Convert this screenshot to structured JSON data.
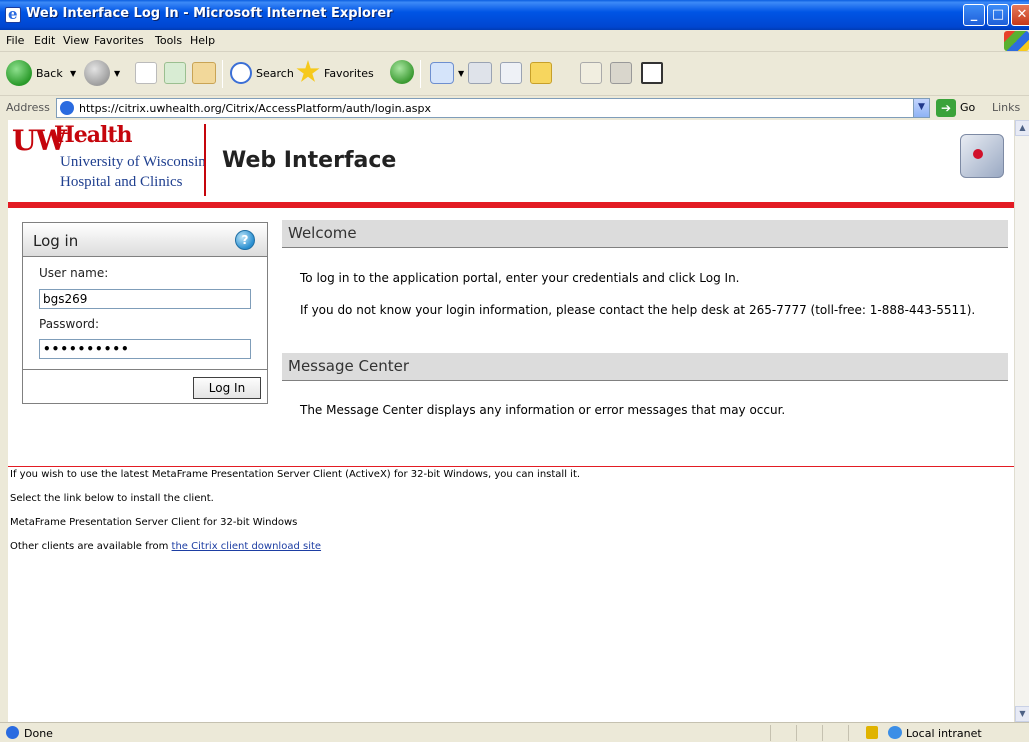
{
  "window": {
    "title": "Web Interface Log In - Microsoft Internet Explorer",
    "minimize": "_",
    "maximize": "□",
    "close": "✕"
  },
  "menu": [
    "File",
    "Edit",
    "View",
    "Favorites",
    "Tools",
    "Help"
  ],
  "toolbar": {
    "back_label": "Back",
    "search_label": "Search",
    "favorites_label": "Favorites"
  },
  "address": {
    "label": "Address",
    "url": "https://citrix.uwhealth.org/Citrix/AccessPlatform/auth/login.aspx",
    "go_label": "Go",
    "links_label": "Links"
  },
  "header": {
    "logo_uw": "UW",
    "logo_health": "Health",
    "sub1": "University of Wisconsin",
    "sub2": "Hospital and Clinics",
    "title": "Web Interface"
  },
  "login": {
    "title": "Log in",
    "username_label": "User name:",
    "username_value": "bgs269",
    "password_label": "Password:",
    "password_value": "••••••••••",
    "button": "Log In"
  },
  "welcome": {
    "heading": "Welcome",
    "line1": "To log in to the application portal, enter your credentials and click Log In.",
    "line2": "If you do not know your login information, please contact the help desk at 265-7777 (toll-free: 1-888-443-5511)."
  },
  "message_center": {
    "heading": "Message Center",
    "text": "The Message Center displays any information or error messages that may occur."
  },
  "client": {
    "line1": "If you wish to use the latest MetaFrame Presentation Server Client (ActiveX) for 32-bit Windows, you can install it.",
    "line2": "Select the link below to install the client.",
    "line3": "MetaFrame Presentation Server Client for 32-bit Windows",
    "line4_prefix": "Other clients are available from ",
    "line4_link": "the Citrix client download site"
  },
  "status": {
    "text": "Done",
    "zone": "Local intranet"
  }
}
